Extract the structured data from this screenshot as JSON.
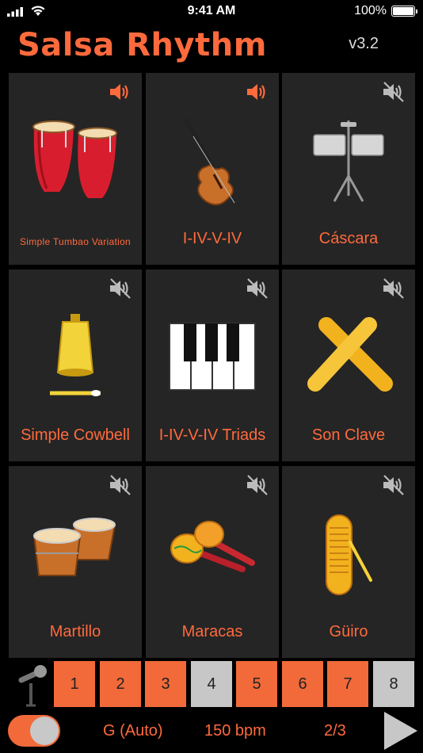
{
  "status_bar": {
    "time": "9:41 AM",
    "battery": "100%"
  },
  "header": {
    "title": "Salsa Rhythm",
    "version": "v3.2"
  },
  "instruments": [
    {
      "label": "Simple Tumbao Variation",
      "icon": "conga-drums-icon",
      "sound": "on"
    },
    {
      "label": "I-IV-V-IV",
      "icon": "bass-icon",
      "sound": "on"
    },
    {
      "label": "Cáscara",
      "icon": "timbales-icon",
      "sound": "muted"
    },
    {
      "label": "Simple Cowbell",
      "icon": "cowbell-icon",
      "sound": "muted"
    },
    {
      "label": "I-IV-V-IV Triads",
      "icon": "piano-icon",
      "sound": "muted"
    },
    {
      "label": "Son Clave",
      "icon": "claves-icon",
      "sound": "muted"
    },
    {
      "label": "Martillo",
      "icon": "bongos-icon",
      "sound": "muted"
    },
    {
      "label": "Maracas",
      "icon": "maracas-icon",
      "sound": "muted"
    },
    {
      "label": "Güiro",
      "icon": "guiro-icon",
      "sound": "muted"
    }
  ],
  "steps": [
    {
      "label": "1",
      "state": "on"
    },
    {
      "label": "2",
      "state": "on"
    },
    {
      "label": "3",
      "state": "on"
    },
    {
      "label": "4",
      "state": "off"
    },
    {
      "label": "5",
      "state": "on"
    },
    {
      "label": "6",
      "state": "on"
    },
    {
      "label": "7",
      "state": "on"
    },
    {
      "label": "8",
      "state": "off"
    }
  ],
  "controls": {
    "key": "G (Auto)",
    "tempo": "150 bpm",
    "meter": "2/3",
    "toggle_on": true
  },
  "colors": {
    "accent": "#ff6a3d",
    "card_bg": "#252525",
    "step_on": "#f26a3a",
    "step_off": "#c7c7c7"
  }
}
